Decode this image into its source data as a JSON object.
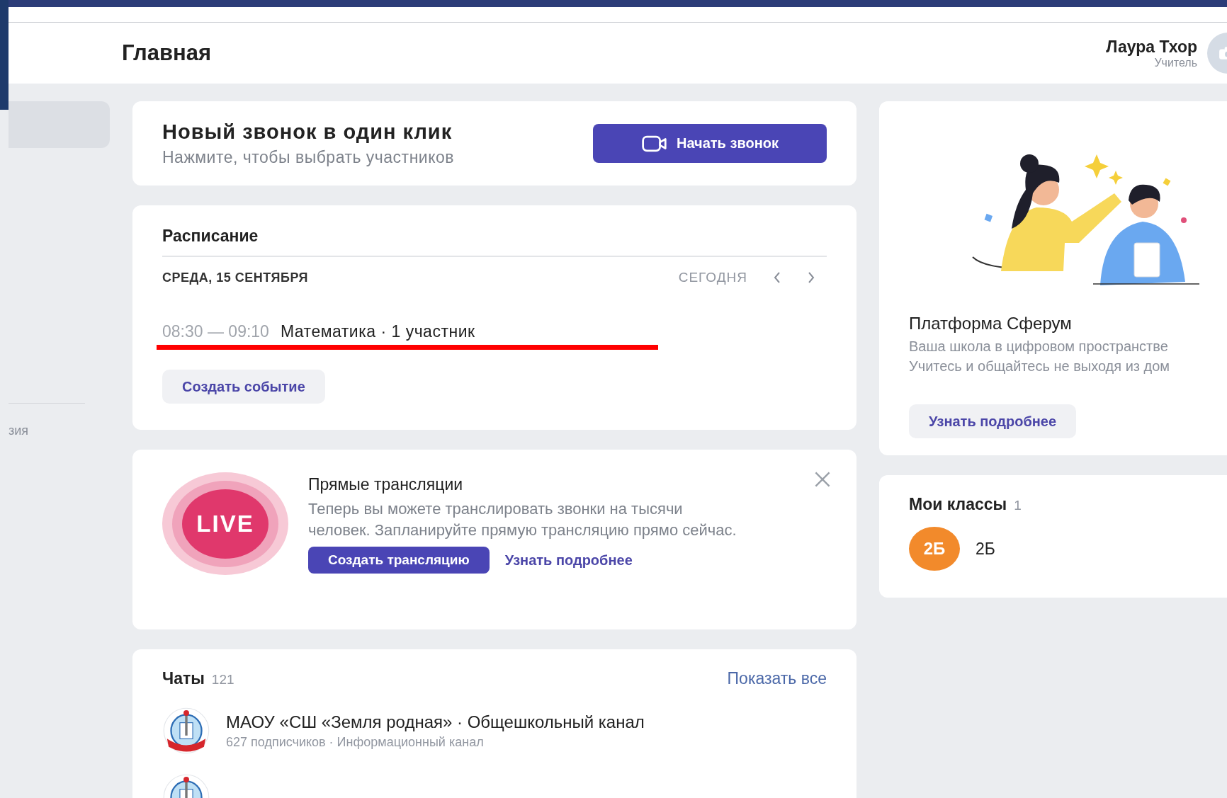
{
  "header": {
    "title": "Главная",
    "user": {
      "name": "Лаура Тхор",
      "role": "Учитель"
    }
  },
  "sidebar": {
    "items": [
      {
        "selected": true
      },
      {
        "label": "зия",
        "selected": false
      }
    ]
  },
  "call_card": {
    "title": "Новый звонок в один клик",
    "subtitle": "Нажмите, чтобы выбрать участников",
    "button": "Начать звонок"
  },
  "schedule": {
    "title": "Расписание",
    "date": "СРЕДА, 15 СЕНТЯБРЯ",
    "today": "СЕГОДНЯ",
    "events": [
      {
        "time": "08:30 — 09:10",
        "title": "Математика · 1 участник",
        "underlined": true
      }
    ],
    "button": "Создать событие"
  },
  "live_card": {
    "badge": "LIVE",
    "title": "Прямые трансляции",
    "text": "Теперь вы можете транслировать звонки на тысячи человек. Запланируйте прямую трансляцию прямо сейчас.",
    "button": "Создать трансляцию",
    "link": "Узнать подробнее"
  },
  "chats": {
    "title": "Чаты",
    "count": "121",
    "show_all": "Показать все",
    "items": [
      {
        "kind": "channel",
        "name": "МАОУ «СШ «Земля родная» · Общешкольный канал",
        "meta": "627 подписчиков · Информационный канал"
      },
      {
        "kind": "avatar_only"
      }
    ]
  },
  "promo": {
    "title": "Платформа Сферум",
    "lines": [
      "Ваша школа в цифровом пространстве",
      "Учитесь и общайтесь не выходя из дом"
    ],
    "button": "Узнать подробнее"
  },
  "classes": {
    "title": "Мои классы",
    "count": "1",
    "items": [
      {
        "badge": "2Б",
        "name": "2Б"
      }
    ]
  }
}
